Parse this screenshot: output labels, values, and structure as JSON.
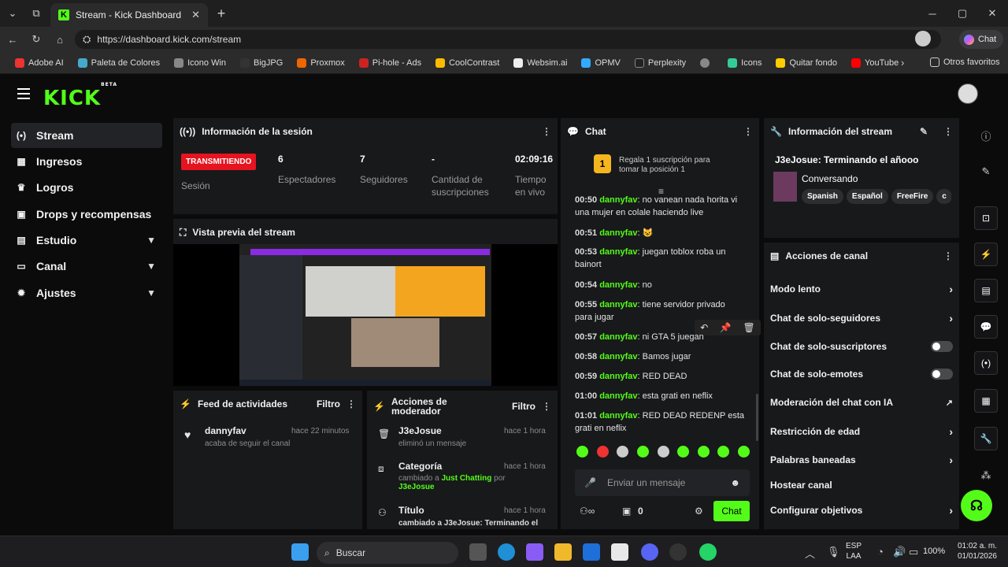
{
  "browser": {
    "tab_title": "Stream - Kick Dashboard",
    "url": "https://dashboard.kick.com/stream",
    "chat_button": "Chat",
    "bookmarks": [
      "Adobe AI",
      "Paleta de Colores",
      "Icono Win",
      "BigJPG",
      "Proxmox",
      "Pi-hole - Ads",
      "CoolContrast",
      "Websim.ai",
      "OPMV",
      "Perplexity",
      "",
      "Icons",
      "Quitar fondo",
      "YouTube"
    ],
    "other_favorites": "Otros favoritos"
  },
  "logo": {
    "text": "KICK",
    "beta": "BETA"
  },
  "sidebar": {
    "items": [
      {
        "label": "Stream",
        "active": true
      },
      {
        "label": "Ingresos"
      },
      {
        "label": "Logros"
      },
      {
        "label": "Drops y recompensas"
      },
      {
        "label": "Estudio"
      },
      {
        "label": "Canal"
      },
      {
        "label": "Ajustes"
      }
    ]
  },
  "session": {
    "title": "Información de la sesión",
    "live_badge": "TRANSMITIENDO",
    "session_label": "Sesión",
    "stats": [
      {
        "value": "6",
        "label": "Espectadores"
      },
      {
        "value": "7",
        "label": "Seguidores"
      },
      {
        "value": "-",
        "label": "Cantidad de suscripciones"
      },
      {
        "value": "02:09:16",
        "label": "Tiempo en vivo"
      }
    ]
  },
  "preview": {
    "title": "Vista previa del stream"
  },
  "feed": {
    "title": "Feed de actividades",
    "filter": "Filtro",
    "items": [
      {
        "user": "dannyfav",
        "time": "hace 22 minutos",
        "desc": "acaba de seguir el canal"
      }
    ]
  },
  "modactions": {
    "title": "Acciones de moderador",
    "filter": "Filtro",
    "items": [
      {
        "title": "J3eJosue",
        "time": "hace 1 hora",
        "desc": "eliminó un mensaje"
      },
      {
        "title": "Categoría",
        "time": "hace 1 hora",
        "desc_pre": "cambiado a ",
        "desc_hl": "Just Chatting",
        "desc_mid": " por ",
        "desc_user": "J3eJosue"
      },
      {
        "title": "Título",
        "time": "hace 1 hora",
        "desc": "cambiado a J3eJosue: Terminando el"
      }
    ]
  },
  "chat": {
    "title": "Chat",
    "gift_rank": "1",
    "gift_text": "Regala 1 suscripción para tomar la posición 1",
    "input_placeholder": "Enviar un mensaje",
    "count": "0",
    "send": "Chat",
    "messages": [
      {
        "time": "00:50",
        "user": "dannyfav",
        "text": "no vanean nada horita vi una mujer en colale haciendo live"
      },
      {
        "time": "00:51",
        "user": "dannyfav",
        "text": "😺"
      },
      {
        "time": "00:53",
        "user": "dannyfav",
        "text": "juegan toblox roba un bainort"
      },
      {
        "time": "00:54",
        "user": "dannyfav",
        "text": "no"
      },
      {
        "time": "00:55",
        "user": "dannyfav",
        "text": "tiene servidor privado para jugar"
      },
      {
        "time": "00:57",
        "user": "dannyfav",
        "text": "ni GTA 5 juegan"
      },
      {
        "time": "00:58",
        "user": "dannyfav",
        "text": "Bamos jugar"
      },
      {
        "time": "00:59",
        "user": "dannyfav",
        "text": "RED DEAD"
      },
      {
        "time": "01:00",
        "user": "dannyfav",
        "text": "esta grati en neflix"
      },
      {
        "time": "01:01",
        "user": "dannyfav",
        "text": "RED DEAD REDENP esta grati en neflix"
      }
    ]
  },
  "streaminfo": {
    "title": "Información del stream",
    "stream_title": "J3eJosue: Terminando el añooo",
    "category": "Conversando",
    "tags": [
      "Spanish",
      "Español",
      "FreeFire",
      "c"
    ]
  },
  "channel_actions": {
    "title": "Acciones de canal",
    "items": [
      {
        "label": "Modo lento",
        "control": "arrow"
      },
      {
        "label": "Chat de solo-seguidores",
        "control": "arrow"
      },
      {
        "label": "Chat de solo-suscriptores",
        "control": "toggle"
      },
      {
        "label": "Chat de solo-emotes",
        "control": "toggle"
      },
      {
        "label": "Moderación del chat con IA",
        "control": "ext"
      },
      {
        "label": "Restricción de edad",
        "control": "arrow"
      },
      {
        "label": "Palabras baneadas",
        "control": "arrow"
      },
      {
        "label": "Hostear canal",
        "control": "none"
      },
      {
        "label": "Configurar objetivos",
        "control": "arrow"
      }
    ]
  },
  "taskbar": {
    "search": "Buscar",
    "lang1": "ESP",
    "lang2": "LAA",
    "battery": "100%",
    "time": "01:02 a. m.",
    "date": "01/01/2026"
  }
}
